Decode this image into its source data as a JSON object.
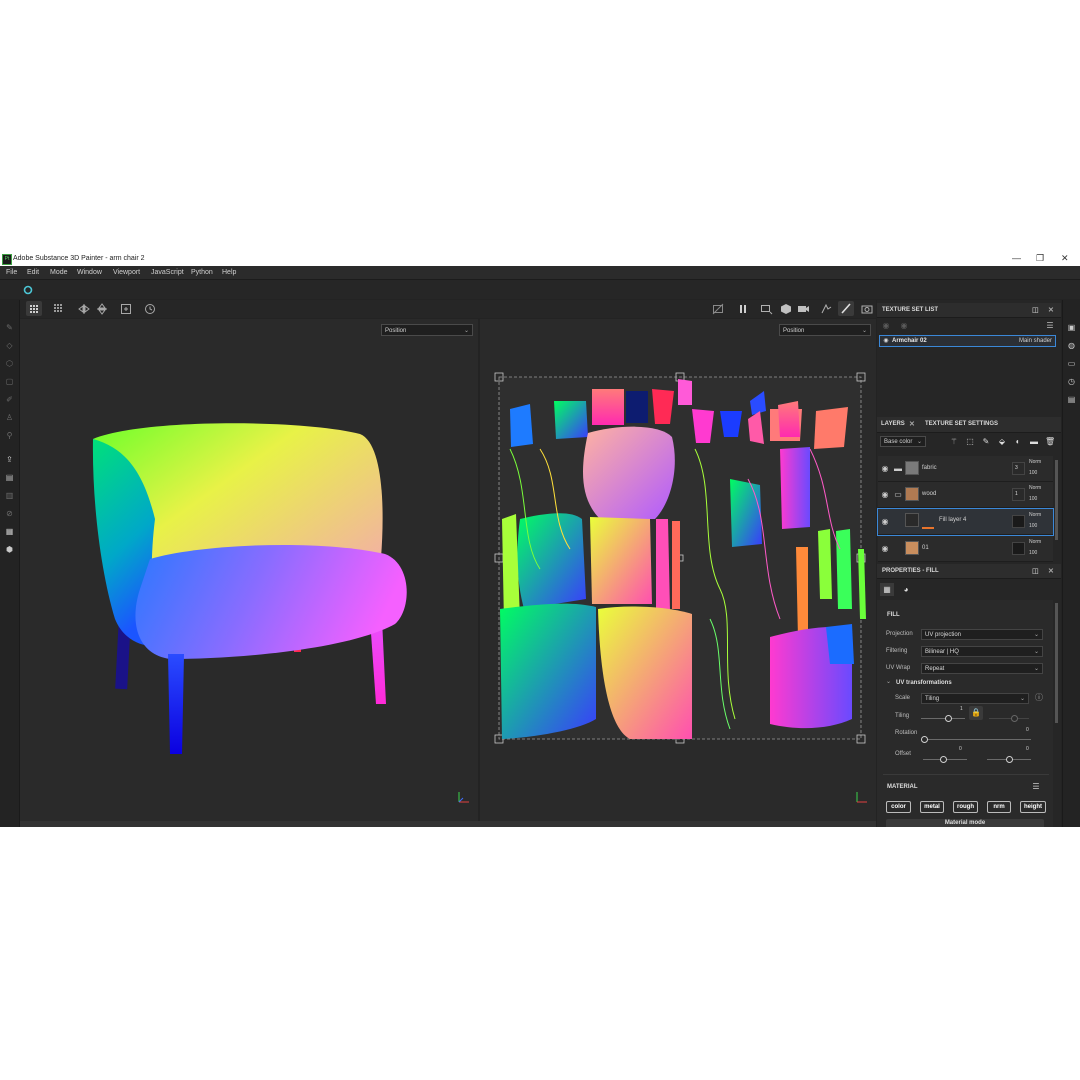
{
  "window": {
    "title": "Adobe Substance 3D Painter - arm chair 2",
    "app_icon": "Pt",
    "controls": [
      "—",
      "❐",
      "✕"
    ]
  },
  "menu": [
    "File",
    "Edit",
    "Mode",
    "Window",
    "Viewport",
    "JavaScript",
    "Python",
    "Help"
  ],
  "viewport3d": {
    "channel": "Position"
  },
  "viewport2d": {
    "channel": "Position"
  },
  "texture_set_list": {
    "title": "TEXTURE SET LIST",
    "item_name": "Armchair 02",
    "item_shader": "Main shader"
  },
  "layers_panel": {
    "tabs": [
      "LAYERS",
      "TEXTURE SET SETTINGS"
    ],
    "channel": "Base color",
    "layers": [
      {
        "name": "fabric",
        "blend": "Norm",
        "opacity": "100",
        "count": "3",
        "thumb": "#7a7a7a",
        "folder": true
      },
      {
        "name": "wood",
        "blend": "Norm",
        "opacity": "100",
        "count": "1",
        "thumb": "#b07a52",
        "folder": true
      },
      {
        "name": "Fill layer 4",
        "blend": "Norm",
        "opacity": "100",
        "count": "",
        "thumb": "#2a2a2a",
        "folder": false
      },
      {
        "name": "01",
        "blend": "Norm",
        "opacity": "100",
        "count": "",
        "thumb": "#c98e5e",
        "folder": false
      }
    ]
  },
  "properties": {
    "title": "PROPERTIES - FILL",
    "section_fill": "FILL",
    "projection_label": "Projection",
    "projection_value": "UV projection",
    "filtering_label": "Filtering",
    "filtering_value": "Bilinear | HQ",
    "uvwrap_label": "UV Wrap",
    "uvwrap_value": "Repeat",
    "uv_transform_label": "UV transformations",
    "scale_label": "Scale",
    "scale_value": "Tiling",
    "tiling_label": "Tiling",
    "tiling_value": "1",
    "rotation_label": "Rotation",
    "rotation_value": "0",
    "offset_label": "Offset",
    "offset_u": "0",
    "offset_v": "0",
    "section_material": "MATERIAL",
    "channels": [
      "color",
      "metal",
      "rough",
      "nrm",
      "height"
    ],
    "material_mode": "Material mode"
  },
  "colors": {
    "accent": "#3b88d8",
    "orange_mark": "#e8742c",
    "panel": "#262626"
  }
}
